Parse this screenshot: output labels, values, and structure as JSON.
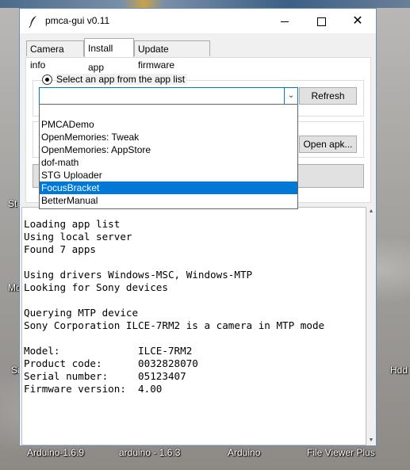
{
  "window": {
    "title": "pmca-gui v0.11"
  },
  "tabs": [
    {
      "label": "Camera info",
      "active": false
    },
    {
      "label": "Install app",
      "active": true
    },
    {
      "label": "Update firmware",
      "active": false
    }
  ],
  "install": {
    "radio_label": "Select an app from the app list",
    "combo_value": "",
    "refresh_label": "Refresh",
    "open_apk_label": "Open apk...",
    "app_list": [
      "PMCADemo",
      "OpenMemories: Tweak",
      "OpenMemories: AppStore",
      "dof-math",
      "STG Uploader",
      "FocusBracket",
      "BetterManual"
    ],
    "selected_app": "FocusBracket"
  },
  "log": {
    "lines": [
      "Loading app list",
      "Using local server",
      "Found 7 apps",
      "",
      "Using drivers Windows-MSC, Windows-MTP",
      "Looking for Sony devices",
      "",
      "Querying MTP device",
      "Sony Corporation ILCE-7RM2 is a camera in MTP mode",
      "",
      "Model:             ILCE-7RM2",
      "Product code:      0032828070",
      "Serial number:     05123407",
      "Firmware version:  4.00"
    ]
  },
  "desktop": {
    "icons": [
      "Arduino-1.6.9",
      "arduino - 1.6.3",
      "Arduino",
      "File Viewer Plus"
    ],
    "edge_fragments": [
      "St",
      "Mo",
      "Sa",
      "Hdd"
    ]
  },
  "colors": {
    "selection": "#0078d7",
    "window_bg": "#f0f0f0"
  }
}
